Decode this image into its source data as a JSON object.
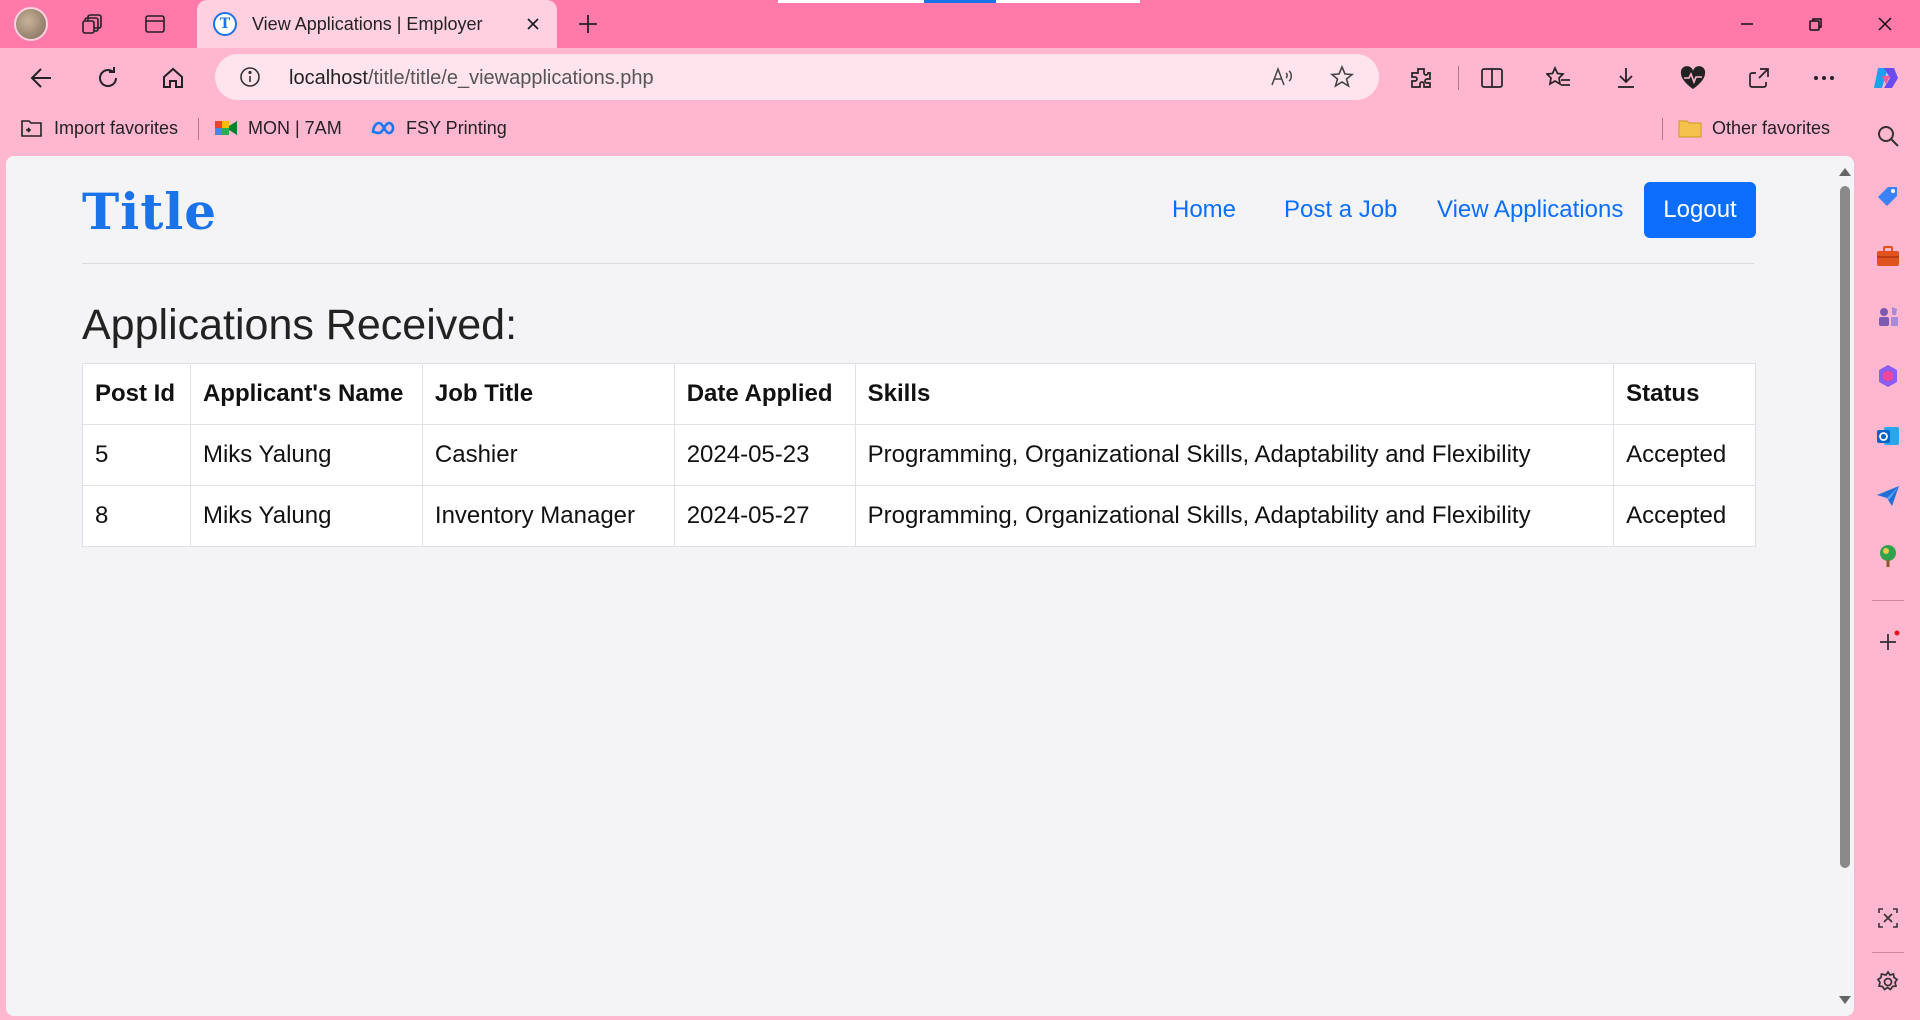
{
  "browser": {
    "tab": {
      "title": "View Applications | Employer",
      "favicon": "T"
    },
    "address": {
      "host": "localhost",
      "path": "/title/title/e_viewapplications.php"
    },
    "favorites": [
      {
        "label": "Import favorites",
        "icon": "import-favorites-icon"
      },
      {
        "label": "MON | 7AM",
        "icon": "google-meet-icon"
      },
      {
        "label": "FSY Printing",
        "icon": "meta-icon"
      }
    ],
    "other_favorites": "Other favorites",
    "colors": {
      "titlebar": "#ff7aa8",
      "toolbar": "#ffb7cf",
      "accent": "#0d6efd"
    }
  },
  "site": {
    "logo": "Title",
    "nav": {
      "home": "Home",
      "post_job": "Post a Job",
      "view_applications": "View Applications",
      "logout": "Logout"
    },
    "heading": "Applications Received:",
    "table": {
      "headers": [
        "Post Id",
        "Applicant's Name",
        "Job Title",
        "Date Applied",
        "Skills",
        "Status"
      ],
      "rows": [
        [
          "5",
          "Miks Yalung",
          "Cashier",
          "2024-05-23",
          "Programming, Organizational Skills, Adaptability and Flexibility",
          "Accepted"
        ],
        [
          "8",
          "Miks Yalung",
          "Inventory Manager",
          "2024-05-27",
          "Programming, Organizational Skills, Adaptability and Flexibility",
          "Accepted"
        ]
      ]
    }
  }
}
